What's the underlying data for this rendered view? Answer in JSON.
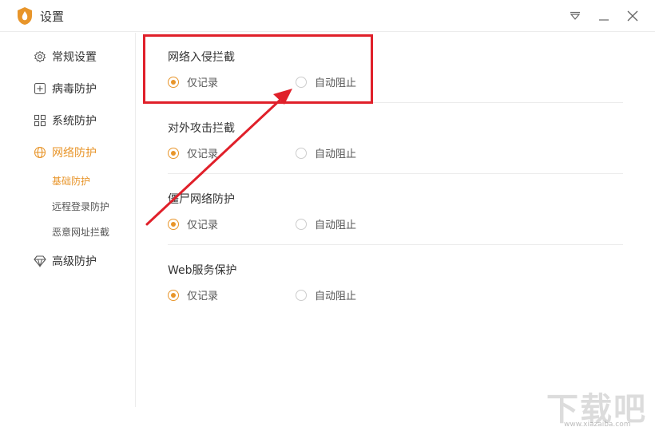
{
  "window": {
    "title": "设置",
    "menu_icon": "dropdown-menu-icon",
    "minimize_icon": "minimize-icon",
    "close_icon": "close-icon"
  },
  "sidebar": {
    "items": [
      {
        "label": "常规设置",
        "icon": "gear-icon"
      },
      {
        "label": "病毒防护",
        "icon": "plus-square-icon"
      },
      {
        "label": "系统防护",
        "icon": "grid-icon"
      },
      {
        "label": "网络防护",
        "icon": "globe-icon",
        "active": true
      },
      {
        "label": "高级防护",
        "icon": "diamond-icon"
      }
    ],
    "sub_items": [
      {
        "label": "基础防护",
        "active": true
      },
      {
        "label": "远程登录防护"
      },
      {
        "label": "恶意网址拦截"
      }
    ]
  },
  "sections": [
    {
      "title": "网络入侵拦截",
      "option_a": "仅记录",
      "option_b": "自动阻止",
      "selected": "option_a"
    },
    {
      "title": "对外攻击拦截",
      "option_a": "仅记录",
      "option_b": "自动阻止",
      "selected": "option_a"
    },
    {
      "title": "僵尸网络防护",
      "option_a": "仅记录",
      "option_b": "自动阻止",
      "selected": "option_a"
    },
    {
      "title": "Web服务保护",
      "option_a": "仅记录",
      "option_b": "自动阻止",
      "selected": "option_a"
    }
  ],
  "colors": {
    "accent": "#e8952a",
    "annotation": "#e0202a"
  },
  "watermark": {
    "text": "下载吧",
    "url": "www.xiazaiba.com"
  }
}
